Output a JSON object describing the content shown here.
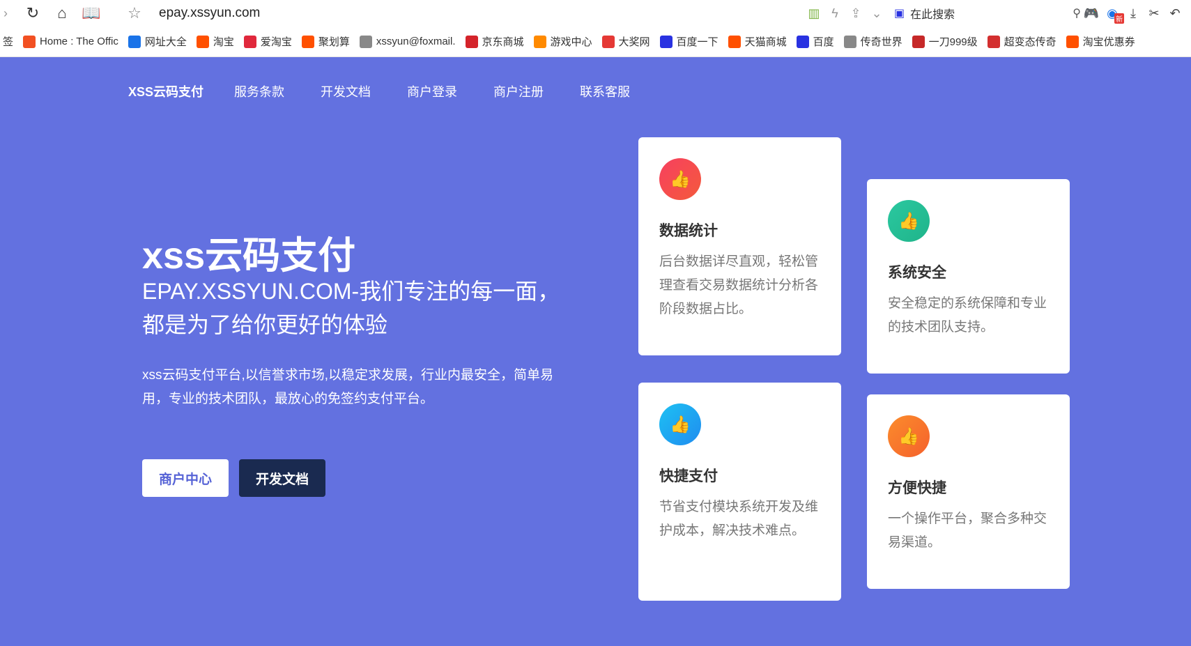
{
  "browser": {
    "url": "epay.xssyun.com",
    "search_placeholder": "在此搜索",
    "new_badge": "新"
  },
  "bookmarks": [
    {
      "label": "签",
      "icon": "",
      "color": ""
    },
    {
      "label": "Home : The Offic",
      "icon": "windows-logo",
      "color": "#f25022"
    },
    {
      "label": "网址大全",
      "icon": "globe",
      "color": "#1a73e8"
    },
    {
      "label": "淘宝",
      "icon": "taobao",
      "color": "#ff5000"
    },
    {
      "label": "爱淘宝",
      "icon": "taobao",
      "color": "#e0283c"
    },
    {
      "label": "聚划算",
      "icon": "taobao",
      "color": "#ff5000"
    },
    {
      "label": "xssyun@foxmail.",
      "icon": "globe",
      "color": "#888888"
    },
    {
      "label": "京东商城",
      "icon": "jd",
      "color": "#d4232a"
    },
    {
      "label": "游戏中心",
      "icon": "gamepad",
      "color": "#ff8a00"
    },
    {
      "label": "大奖网",
      "icon": "star",
      "color": "#e53935"
    },
    {
      "label": "百度一下",
      "icon": "baidu",
      "color": "#2932e1"
    },
    {
      "label": "天猫商城",
      "icon": "taobao",
      "color": "#ff5000"
    },
    {
      "label": "百度",
      "icon": "baidu",
      "color": "#2932e1"
    },
    {
      "label": "传奇世界",
      "icon": "globe",
      "color": "#888888"
    },
    {
      "label": "一刀999级",
      "icon": "game",
      "color": "#c62828"
    },
    {
      "label": "超变态传奇",
      "icon": "game",
      "color": "#d32f2f"
    },
    {
      "label": "淘宝优惠券",
      "icon": "taobao",
      "color": "#ff5000"
    }
  ],
  "nav": {
    "brand": "XSS云码支付",
    "items": [
      "服务条款",
      "开发文档",
      "商户登录",
      "商户注册",
      "联系客服"
    ]
  },
  "hero": {
    "title": "xss云码支付",
    "subtitle": "EPAY.XSSYUN.COM-我们专注的每一面，都是为了给你更好的体验",
    "description": "xss云码支付平台,以信誉求市场,以稳定求发展，行业内最安全，简单易用，专业的技术团队，最放心的免签约支付平台。",
    "btn_merchant": "商户中心",
    "btn_docs": "开发文档"
  },
  "features": [
    {
      "title": "数据统计",
      "text": "后台数据详尽直观，轻松管理查看交易数据统计分析各阶段数据占比。",
      "color_from": "#f7405f",
      "color_to": "#f45a3c",
      "icon": "thumb-icon"
    },
    {
      "title": "系统安全",
      "text": "安全稳定的系统保障和专业的技术团队支持。",
      "color_from": "#2bc8a0",
      "color_to": "#1fb48a",
      "icon": "thumb-icon"
    },
    {
      "title": "快捷支付",
      "text": "节省支付模块系统开发及维护成本，解决技术难点。",
      "color_from": "#1ec1f2",
      "color_to": "#1f8cf0",
      "icon": "thumb-icon"
    },
    {
      "title": "方便快捷",
      "text": "一个操作平台，聚合多种交易渠道。",
      "color_from": "#fb8c2c",
      "color_to": "#f5612c",
      "icon": "thumb-icon"
    }
  ]
}
